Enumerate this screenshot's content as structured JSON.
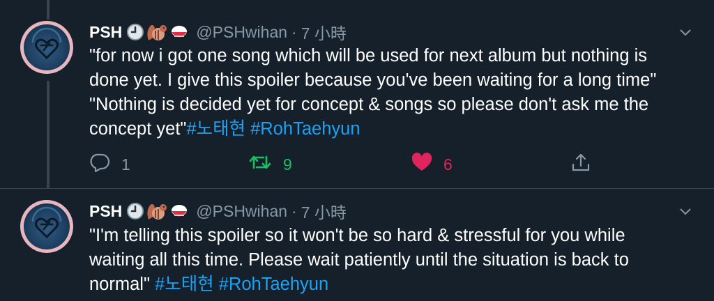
{
  "tweets": [
    {
      "name": "PSH",
      "handle": "@PSHwihan",
      "separator": "·",
      "time": "7 小時",
      "line1": "\"for now i got one song which will be used for next album but nothing is",
      "line2": "done yet. I give this spoiler because you've been waiting for a long time\"",
      "line3": "\"Nothing is decided yet for concept & songs so please don't ask me the",
      "line4": "concept yet\"",
      "tag1": "#노태현",
      "tag2": "#RohTaehyun",
      "replies": "1",
      "retweets": "9",
      "likes": "6"
    },
    {
      "name": "PSH",
      "handle": "@PSHwihan",
      "separator": "·",
      "time": "7 小時",
      "line1": "\"I'm telling this spoiler so it won't be so hard & stressful for you while",
      "line2": "waiting all this time. Please wait patiently until the situation is back to",
      "line3": "normal\" ",
      "tag1": "#노태현",
      "tag2": "#RohTaehyun"
    }
  ],
  "colors": {
    "background": "#15202b",
    "text": "#ffffff",
    "muted": "#8899a6",
    "link": "#1da1f2",
    "retweet": "#17bf63",
    "like": "#e0245e"
  },
  "icons": [
    "clock-emoji-icon",
    "chipmunk-emoji-icon",
    "rice-bowl-emoji-icon",
    "chevron-down-icon",
    "reply-icon",
    "retweet-icon",
    "heart-icon",
    "share-icon"
  ]
}
